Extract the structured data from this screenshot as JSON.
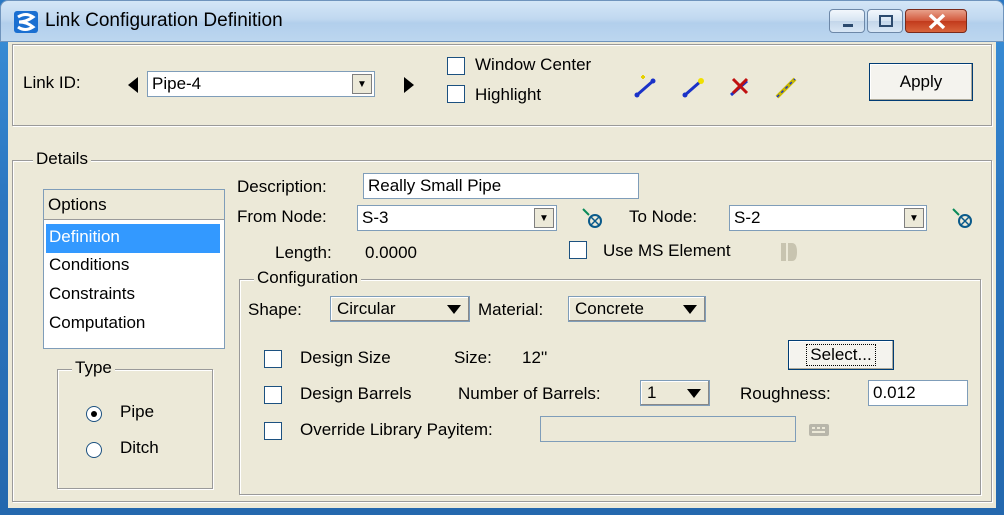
{
  "window": {
    "title": "Link Configuration Definition"
  },
  "top": {
    "link_id_label": "Link ID:",
    "link_id_value": "Pipe-4",
    "window_center_label": "Window Center",
    "window_center_checked": false,
    "highlight_label": "Highlight",
    "highlight_checked": false,
    "apply_label": "Apply"
  },
  "details": {
    "legend": "Details",
    "options_header": "Options",
    "options": [
      "Definition",
      "Conditions",
      "Constraints",
      "Computation"
    ],
    "selected_option": "Definition",
    "type": {
      "legend": "Type",
      "pipe_label": "Pipe",
      "ditch_label": "Ditch",
      "selected": "Pipe"
    },
    "description_label": "Description:",
    "description_value": "Really Small Pipe",
    "from_node_label": "From Node:",
    "from_node_value": "S-3",
    "to_node_label": "To Node:",
    "to_node_value": "S-2",
    "length_label": "Length:",
    "length_value": "0.0000",
    "use_ms_label": "Use MS Element",
    "use_ms_checked": false,
    "configuration": {
      "legend": "Configuration",
      "shape_label": "Shape:",
      "shape_value": "Circular",
      "material_label": "Material:",
      "material_value": "Concrete",
      "design_size_label": "Design Size",
      "design_size_checked": false,
      "size_label": "Size:",
      "size_value": "12''",
      "select_label": "Select...",
      "design_barrels_label": "Design Barrels",
      "design_barrels_checked": false,
      "barrels_label": "Number of Barrels:",
      "barrels_value": "1",
      "roughness_label": "Roughness:",
      "roughness_value": "0.012",
      "override_label": "Override Library Payitem:",
      "override_checked": false,
      "payitem_value": ""
    }
  },
  "colors": {
    "selection": "#3399ff",
    "dialog_bg": "#ece9d8",
    "title_bar": "#c0d8f0"
  }
}
